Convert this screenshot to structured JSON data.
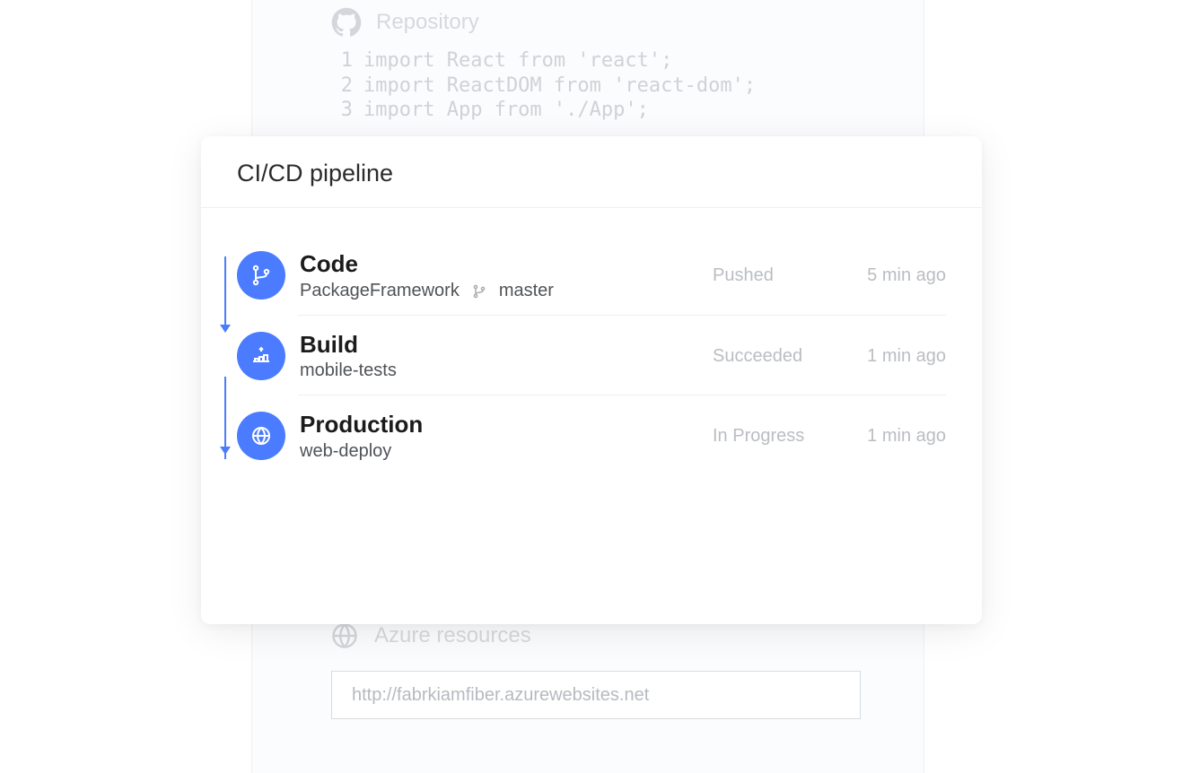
{
  "background": {
    "repo_header": "Repository",
    "code_lines": [
      "import React from 'react';",
      "import ReactDOM from 'react-dom';",
      "import App from './App';"
    ],
    "resources_header": "Azure resources",
    "url": "http://fabrkiamfiber.azurewebsites.net"
  },
  "card": {
    "title": "CI/CD pipeline",
    "stages": [
      {
        "title": "Code",
        "subtitle": "PackageFramework",
        "branch": "master",
        "status": "Pushed",
        "time": "5 min ago",
        "icon": "branch"
      },
      {
        "title": "Build",
        "subtitle": "mobile-tests",
        "branch": "",
        "status": "Succeeded",
        "time": "1 min ago",
        "icon": "build"
      },
      {
        "title": "Production",
        "subtitle": "web-deploy",
        "branch": "",
        "status": "In Progress",
        "time": "1 min ago",
        "icon": "globe"
      }
    ]
  }
}
